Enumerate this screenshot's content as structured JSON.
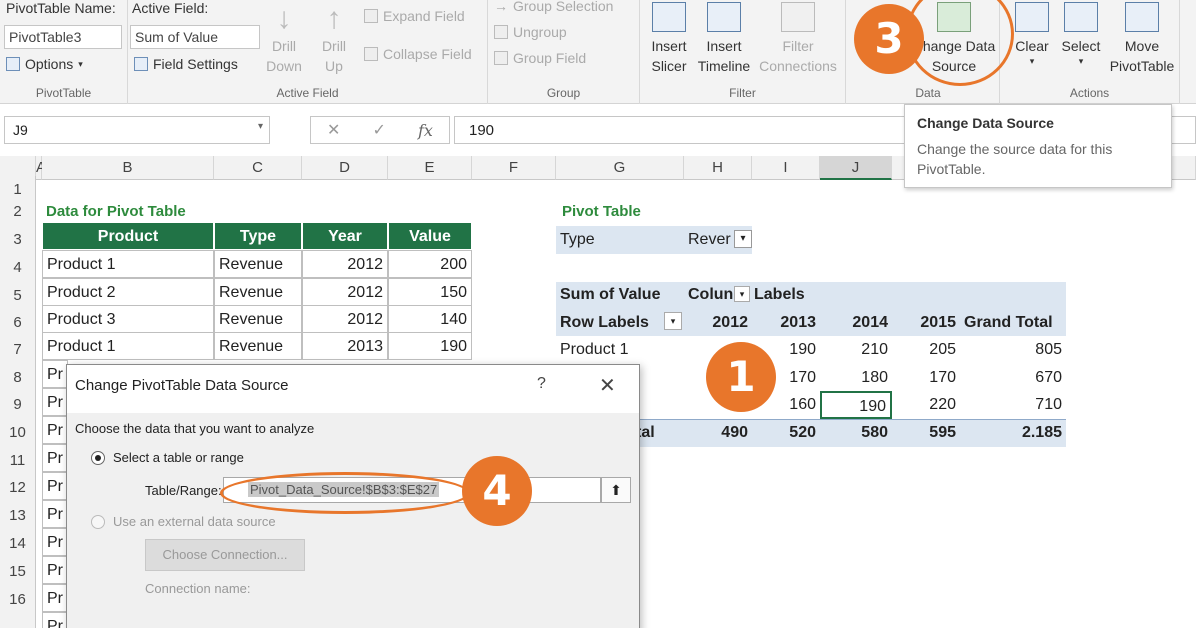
{
  "ribbon": {
    "pivottable_name_label": "PivotTable Name:",
    "pivottable_name_value": "PivotTable3",
    "options_label": "Options",
    "group_pivottable": "PivotTable",
    "active_field_label": "Active Field:",
    "active_field_value": "Sum of Value",
    "field_settings_label": "Field Settings",
    "drill_down_label": "Drill Down",
    "drill_up_label": "Drill Up",
    "expand_field_label": "Expand Field",
    "collapse_field_label": "Collapse Field",
    "group_active_field": "Active Field",
    "group_selection_label": "Group Selection",
    "ungroup_label": "Ungroup",
    "group_field_label": "Group Field",
    "group_group": "Group",
    "insert_slicer_label": "Insert Slicer",
    "insert_timeline_label": "Insert Timeline",
    "filter_connections_label": "Filter Connections",
    "group_filter": "Filter",
    "change_data_source_label": "Change Data Source",
    "group_data": "Data",
    "clear_label": "Clear",
    "select_label": "Select",
    "move_pivottable_label": "Move PivotTable",
    "group_actions": "Actions"
  },
  "formula_bar": {
    "name_box": "J9",
    "formula": "190",
    "cancel_glyph": "✕",
    "enter_glyph": "✓",
    "fx_glyph": "fx"
  },
  "columns": [
    "A",
    "B",
    "C",
    "D",
    "E",
    "F",
    "G",
    "H",
    "I",
    "J"
  ],
  "rows": [
    "1",
    "2",
    "3",
    "4",
    "5",
    "6",
    "7",
    "8",
    "9",
    "10",
    "11",
    "12",
    "13",
    "14",
    "15",
    "16"
  ],
  "source_table": {
    "title": "Data for Pivot Table",
    "headers": [
      "Product",
      "Type",
      "Year",
      "Value"
    ],
    "rows": [
      [
        "Product 1",
        "Revenue",
        "2012",
        "200"
      ],
      [
        "Product 2",
        "Revenue",
        "2012",
        "150"
      ],
      [
        "Product 3",
        "Revenue",
        "2012",
        "140"
      ],
      [
        "Product 1",
        "Revenue",
        "2013",
        "190"
      ]
    ],
    "truncated_label": "Pr"
  },
  "pivot": {
    "title": "Pivot Table",
    "filter_label": "Type",
    "filter_value": "Rever",
    "sum_label": "Sum of Value",
    "column_labels_a": "Colun",
    "column_labels_b": "Labels",
    "row_labels": "Row Labels",
    "years": [
      "2012",
      "2013",
      "2014",
      "2015"
    ],
    "grand_total_header": "Grand Total",
    "product1_label": "Product 1",
    "product1": [
      "190",
      "210",
      "205",
      "805"
    ],
    "row2": [
      "170",
      "180",
      "170",
      "670"
    ],
    "row3": [
      "160",
      "190",
      "220",
      "710"
    ],
    "total_label_fragment": "tal",
    "totals": [
      "490",
      "520",
      "580",
      "595",
      "2.185"
    ]
  },
  "tooltip": {
    "title": "Change Data Source",
    "body": "Change the source data for this PivotTable."
  },
  "dialog": {
    "title": "Change PivotTable Data Source",
    "help_glyph": "?",
    "close_glyph": "✕",
    "instruction": "Choose the data that you want to analyze",
    "option_table": "Select a table or range",
    "table_range_label": "Table/Range:",
    "table_range_value": "Pivot_Data_Source!$B$3:$E$27",
    "option_external": "Use an external data source",
    "choose_connection": "Choose Connection...",
    "connection_name": "Connection name:"
  },
  "annotations": [
    "1",
    "3",
    "4"
  ],
  "colors": {
    "excel_green": "#217346",
    "pivot_band": "#dce6f1",
    "annotation_orange": "#e8762b"
  }
}
